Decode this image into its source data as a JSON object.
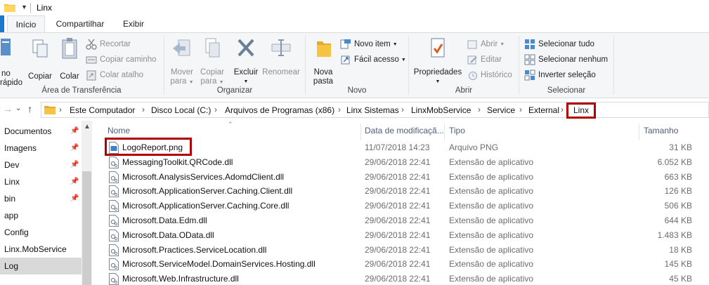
{
  "window": {
    "title": "Linx"
  },
  "tabs": [
    {
      "label": "Início"
    },
    {
      "label": "Compartilhar"
    },
    {
      "label": "Exibir"
    }
  ],
  "ribbon": {
    "clipboard": {
      "group_label": "Área de Transferência",
      "pin_label_1": "no",
      "pin_label_2": "rápido",
      "copy_label": "Copiar",
      "paste_label": "Colar",
      "cut_label": "Recortar",
      "copy_path_label": "Copiar caminho",
      "paste_shortcut_label": "Colar atalho"
    },
    "organize": {
      "group_label": "Organizar",
      "move_label_1": "Mover",
      "move_label_2": "para",
      "copyto_label_1": "Copiar",
      "copyto_label_2": "para",
      "delete_label": "Excluir",
      "rename_label": "Renomear"
    },
    "new": {
      "group_label": "Novo",
      "new_folder_label_1": "Nova",
      "new_folder_label_2": "pasta",
      "new_item_label": "Novo item",
      "easy_access_label": "Fácil acesso"
    },
    "open": {
      "group_label": "Abrir",
      "properties_label": "Propriedades",
      "open_label": "Abrir",
      "edit_label": "Editar",
      "history_label": "Histórico"
    },
    "select": {
      "group_label": "Selecionar",
      "select_all_label": "Selecionar tudo",
      "select_none_label": "Selecionar nenhum",
      "invert_label": "Inverter seleção"
    }
  },
  "address": {
    "crumbs": [
      "Este Computador",
      "Disco Local (C:)",
      "Arquivos de Programas (x86)",
      "Linx Sistemas",
      "LinxMobService",
      "Service",
      "External",
      "Linx"
    ]
  },
  "navpane": {
    "items": [
      {
        "label": "Documentos"
      },
      {
        "label": "Imagens"
      },
      {
        "label": "Dev"
      },
      {
        "label": "Linx"
      },
      {
        "label": "bin"
      },
      {
        "label": "app"
      },
      {
        "label": "Config"
      },
      {
        "label": "Linx.MobService"
      },
      {
        "label": "Log"
      }
    ]
  },
  "filelist": {
    "columns": {
      "name": "Nome",
      "date": "Data de modificaçã...",
      "type": "Tipo",
      "size": "Tamanho"
    },
    "rows": [
      {
        "name": "LogoReport.png",
        "date": "11/07/2018 14:23",
        "type": "Arquivo PNG",
        "size": "31 KB"
      },
      {
        "name": "MessagingToolkit.QRCode.dll",
        "date": "29/06/2018 22:41",
        "type": "Extensão de aplicativo",
        "size": "6.052 KB"
      },
      {
        "name": "Microsoft.AnalysisServices.AdomdClient.dll",
        "date": "29/06/2018 22:41",
        "type": "Extensão de aplicativo",
        "size": "663 KB"
      },
      {
        "name": "Microsoft.ApplicationServer.Caching.Client.dll",
        "date": "29/06/2018 22:41",
        "type": "Extensão de aplicativo",
        "size": "126 KB"
      },
      {
        "name": "Microsoft.ApplicationServer.Caching.Core.dll",
        "date": "29/06/2018 22:41",
        "type": "Extensão de aplicativo",
        "size": "506 KB"
      },
      {
        "name": "Microsoft.Data.Edm.dll",
        "date": "29/06/2018 22:41",
        "type": "Extensão de aplicativo",
        "size": "644 KB"
      },
      {
        "name": "Microsoft.Data.OData.dll",
        "date": "29/06/2018 22:41",
        "type": "Extensão de aplicativo",
        "size": "1.483 KB"
      },
      {
        "name": "Microsoft.Practices.ServiceLocation.dll",
        "date": "29/06/2018 22:41",
        "type": "Extensão de aplicativo",
        "size": "18 KB"
      },
      {
        "name": "Microsoft.ServiceModel.DomainServices.Hosting.dll",
        "date": "29/06/2018 22:41",
        "type": "Extensão de aplicativo",
        "size": "145 KB"
      },
      {
        "name": "Microsoft.Web.Infrastructure.dll",
        "date": "29/06/2018 22:41",
        "type": "Extensão de aplicativo",
        "size": "45 KB"
      }
    ]
  },
  "colors": {
    "highlight": "#b00000",
    "accent": "#1979ca",
    "folder": "#f6c343"
  }
}
